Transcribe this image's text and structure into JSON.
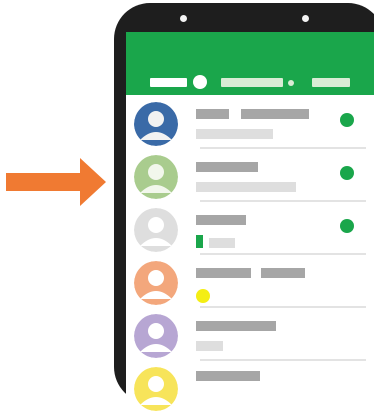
{
  "colors": {
    "header": "#1aa64b",
    "online": "#1aa64b",
    "arrow": "#f07a32",
    "phone_frame": "#1e1e1e",
    "name_bar": "#a6a6a6",
    "preview_bar": "#dedede",
    "unread_dot": "#f4ee14"
  },
  "header": {
    "icons": [
      "camera-icon",
      "search-icon"
    ]
  },
  "contacts": [
    {
      "avatar_bg": "#3a6aa7",
      "avatar_fg": "#f2f2f2",
      "online": true,
      "icon": "user-avatar-icon"
    },
    {
      "avatar_bg": "#a9cc8e",
      "avatar_fg": "#f2f7ec",
      "online": true,
      "icon": "user-avatar-icon"
    },
    {
      "avatar_bg": "#dedede",
      "avatar_fg": "#ffffff",
      "online": true,
      "icon": "user-avatar-icon"
    },
    {
      "avatar_bg": "#f3a77c",
      "avatar_fg": "#ffffff",
      "online": false,
      "icon": "user-avatar-icon"
    },
    {
      "avatar_bg": "#b7a6d3",
      "avatar_fg": "#ffffff",
      "online": false,
      "icon": "user-avatar-icon"
    },
    {
      "avatar_bg": "#f7e45a",
      "avatar_fg": "#ffffff",
      "online": false,
      "icon": "user-avatar-icon"
    }
  ]
}
